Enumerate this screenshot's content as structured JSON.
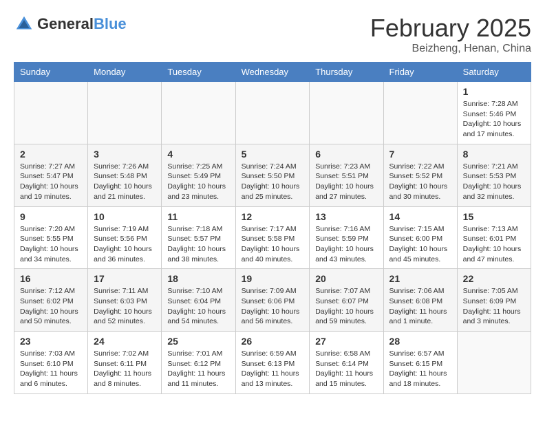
{
  "header": {
    "logo_general": "General",
    "logo_blue": "Blue",
    "month": "February 2025",
    "location": "Beizheng, Henan, China"
  },
  "days_of_week": [
    "Sunday",
    "Monday",
    "Tuesday",
    "Wednesday",
    "Thursday",
    "Friday",
    "Saturday"
  ],
  "weeks": [
    [
      {
        "day": "",
        "info": ""
      },
      {
        "day": "",
        "info": ""
      },
      {
        "day": "",
        "info": ""
      },
      {
        "day": "",
        "info": ""
      },
      {
        "day": "",
        "info": ""
      },
      {
        "day": "",
        "info": ""
      },
      {
        "day": "1",
        "info": "Sunrise: 7:28 AM\nSunset: 5:46 PM\nDaylight: 10 hours and 17 minutes."
      }
    ],
    [
      {
        "day": "2",
        "info": "Sunrise: 7:27 AM\nSunset: 5:47 PM\nDaylight: 10 hours and 19 minutes."
      },
      {
        "day": "3",
        "info": "Sunrise: 7:26 AM\nSunset: 5:48 PM\nDaylight: 10 hours and 21 minutes."
      },
      {
        "day": "4",
        "info": "Sunrise: 7:25 AM\nSunset: 5:49 PM\nDaylight: 10 hours and 23 minutes."
      },
      {
        "day": "5",
        "info": "Sunrise: 7:24 AM\nSunset: 5:50 PM\nDaylight: 10 hours and 25 minutes."
      },
      {
        "day": "6",
        "info": "Sunrise: 7:23 AM\nSunset: 5:51 PM\nDaylight: 10 hours and 27 minutes."
      },
      {
        "day": "7",
        "info": "Sunrise: 7:22 AM\nSunset: 5:52 PM\nDaylight: 10 hours and 30 minutes."
      },
      {
        "day": "8",
        "info": "Sunrise: 7:21 AM\nSunset: 5:53 PM\nDaylight: 10 hours and 32 minutes."
      }
    ],
    [
      {
        "day": "9",
        "info": "Sunrise: 7:20 AM\nSunset: 5:55 PM\nDaylight: 10 hours and 34 minutes."
      },
      {
        "day": "10",
        "info": "Sunrise: 7:19 AM\nSunset: 5:56 PM\nDaylight: 10 hours and 36 minutes."
      },
      {
        "day": "11",
        "info": "Sunrise: 7:18 AM\nSunset: 5:57 PM\nDaylight: 10 hours and 38 minutes."
      },
      {
        "day": "12",
        "info": "Sunrise: 7:17 AM\nSunset: 5:58 PM\nDaylight: 10 hours and 40 minutes."
      },
      {
        "day": "13",
        "info": "Sunrise: 7:16 AM\nSunset: 5:59 PM\nDaylight: 10 hours and 43 minutes."
      },
      {
        "day": "14",
        "info": "Sunrise: 7:15 AM\nSunset: 6:00 PM\nDaylight: 10 hours and 45 minutes."
      },
      {
        "day": "15",
        "info": "Sunrise: 7:13 AM\nSunset: 6:01 PM\nDaylight: 10 hours and 47 minutes."
      }
    ],
    [
      {
        "day": "16",
        "info": "Sunrise: 7:12 AM\nSunset: 6:02 PM\nDaylight: 10 hours and 50 minutes."
      },
      {
        "day": "17",
        "info": "Sunrise: 7:11 AM\nSunset: 6:03 PM\nDaylight: 10 hours and 52 minutes."
      },
      {
        "day": "18",
        "info": "Sunrise: 7:10 AM\nSunset: 6:04 PM\nDaylight: 10 hours and 54 minutes."
      },
      {
        "day": "19",
        "info": "Sunrise: 7:09 AM\nSunset: 6:06 PM\nDaylight: 10 hours and 56 minutes."
      },
      {
        "day": "20",
        "info": "Sunrise: 7:07 AM\nSunset: 6:07 PM\nDaylight: 10 hours and 59 minutes."
      },
      {
        "day": "21",
        "info": "Sunrise: 7:06 AM\nSunset: 6:08 PM\nDaylight: 11 hours and 1 minute."
      },
      {
        "day": "22",
        "info": "Sunrise: 7:05 AM\nSunset: 6:09 PM\nDaylight: 11 hours and 3 minutes."
      }
    ],
    [
      {
        "day": "23",
        "info": "Sunrise: 7:03 AM\nSunset: 6:10 PM\nDaylight: 11 hours and 6 minutes."
      },
      {
        "day": "24",
        "info": "Sunrise: 7:02 AM\nSunset: 6:11 PM\nDaylight: 11 hours and 8 minutes."
      },
      {
        "day": "25",
        "info": "Sunrise: 7:01 AM\nSunset: 6:12 PM\nDaylight: 11 hours and 11 minutes."
      },
      {
        "day": "26",
        "info": "Sunrise: 6:59 AM\nSunset: 6:13 PM\nDaylight: 11 hours and 13 minutes."
      },
      {
        "day": "27",
        "info": "Sunrise: 6:58 AM\nSunset: 6:14 PM\nDaylight: 11 hours and 15 minutes."
      },
      {
        "day": "28",
        "info": "Sunrise: 6:57 AM\nSunset: 6:15 PM\nDaylight: 11 hours and 18 minutes."
      },
      {
        "day": "",
        "info": ""
      }
    ]
  ]
}
